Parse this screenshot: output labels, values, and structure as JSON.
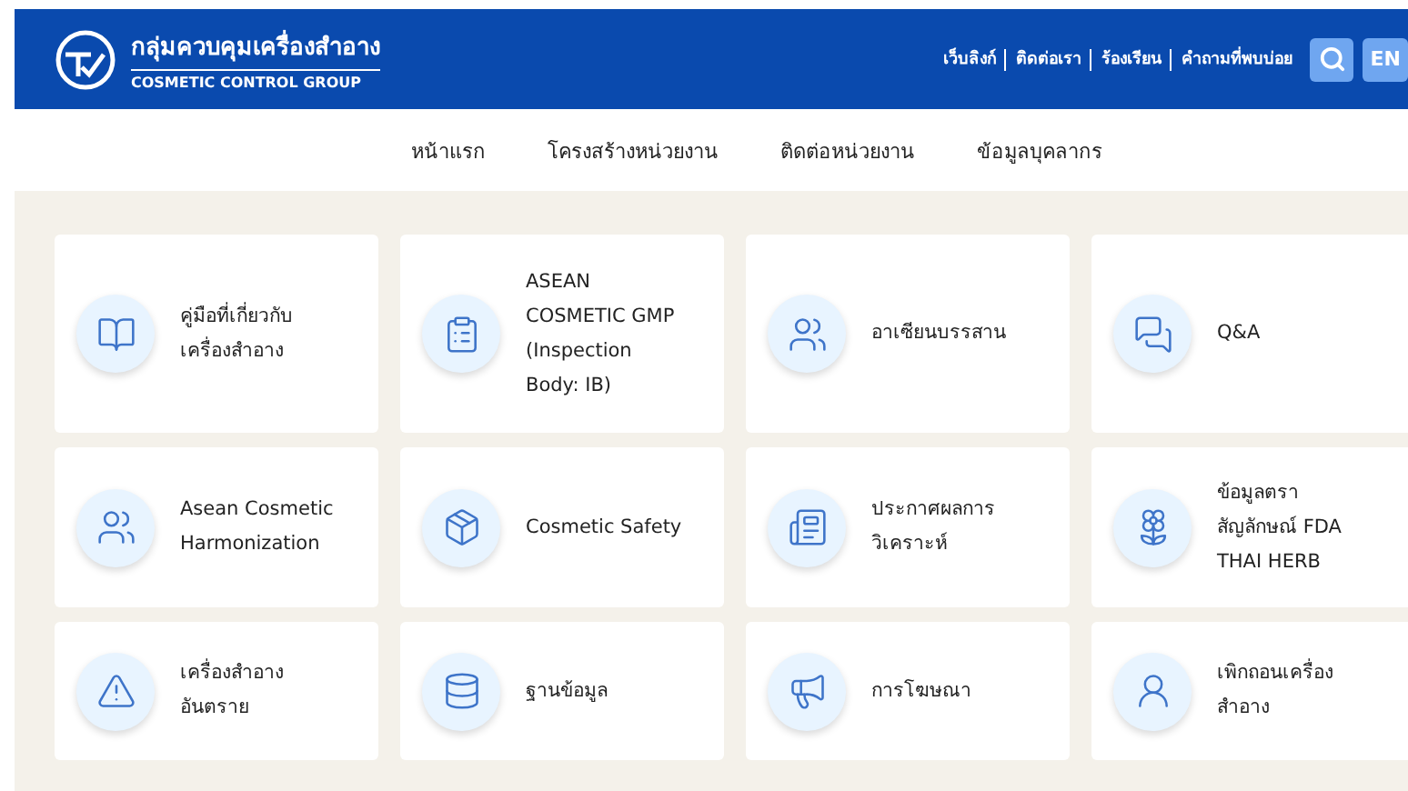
{
  "header": {
    "title_th": "กลุ่มควบคุมเครื่องสำอาง",
    "title_en": "COSMETIC CONTROL GROUP",
    "links": [
      "เว็บลิงก์",
      "ติดต่อเรา",
      "ร้องเรียน",
      "คำถามที่พบบ่อย"
    ],
    "language": "EN"
  },
  "nav": [
    "หน้าแรก",
    "โครงสร้างหน่วยงาน",
    "ติดต่อหน่วยงาน",
    "ข้อมูลบุคลากร"
  ],
  "cards": [
    {
      "lines": [
        "คู่มือที่เกี่ยวกับ",
        "เครื่องสำอาง"
      ]
    },
    {
      "lines": [
        "ASEAN",
        "COSMETIC GMP",
        "(Inspection",
        "Body: IB)"
      ]
    },
    {
      "lines": [
        "อาเซียนบรรสาน"
      ]
    },
    {
      "lines": [
        "Q&A"
      ]
    },
    {
      "lines": [
        "Asean Cosmetic",
        "Harmonization"
      ]
    },
    {
      "lines": [
        "Cosmetic Safety"
      ]
    },
    {
      "lines": [
        "ประกาศผลการ",
        "วิเคราะห์"
      ]
    },
    {
      "lines": [
        "ข้อมูลตรา",
        "สัญลักษณ์ FDA",
        "THAI HERB"
      ]
    },
    {
      "lines": [
        "เครื่องสำอาง",
        "อันตราย"
      ]
    },
    {
      "lines": [
        "ฐานข้อมูล"
      ]
    },
    {
      "lines": [
        "การโฆษณา"
      ]
    },
    {
      "lines": [
        "เพิกถอนเครื่อง",
        "สำอาง"
      ]
    }
  ]
}
